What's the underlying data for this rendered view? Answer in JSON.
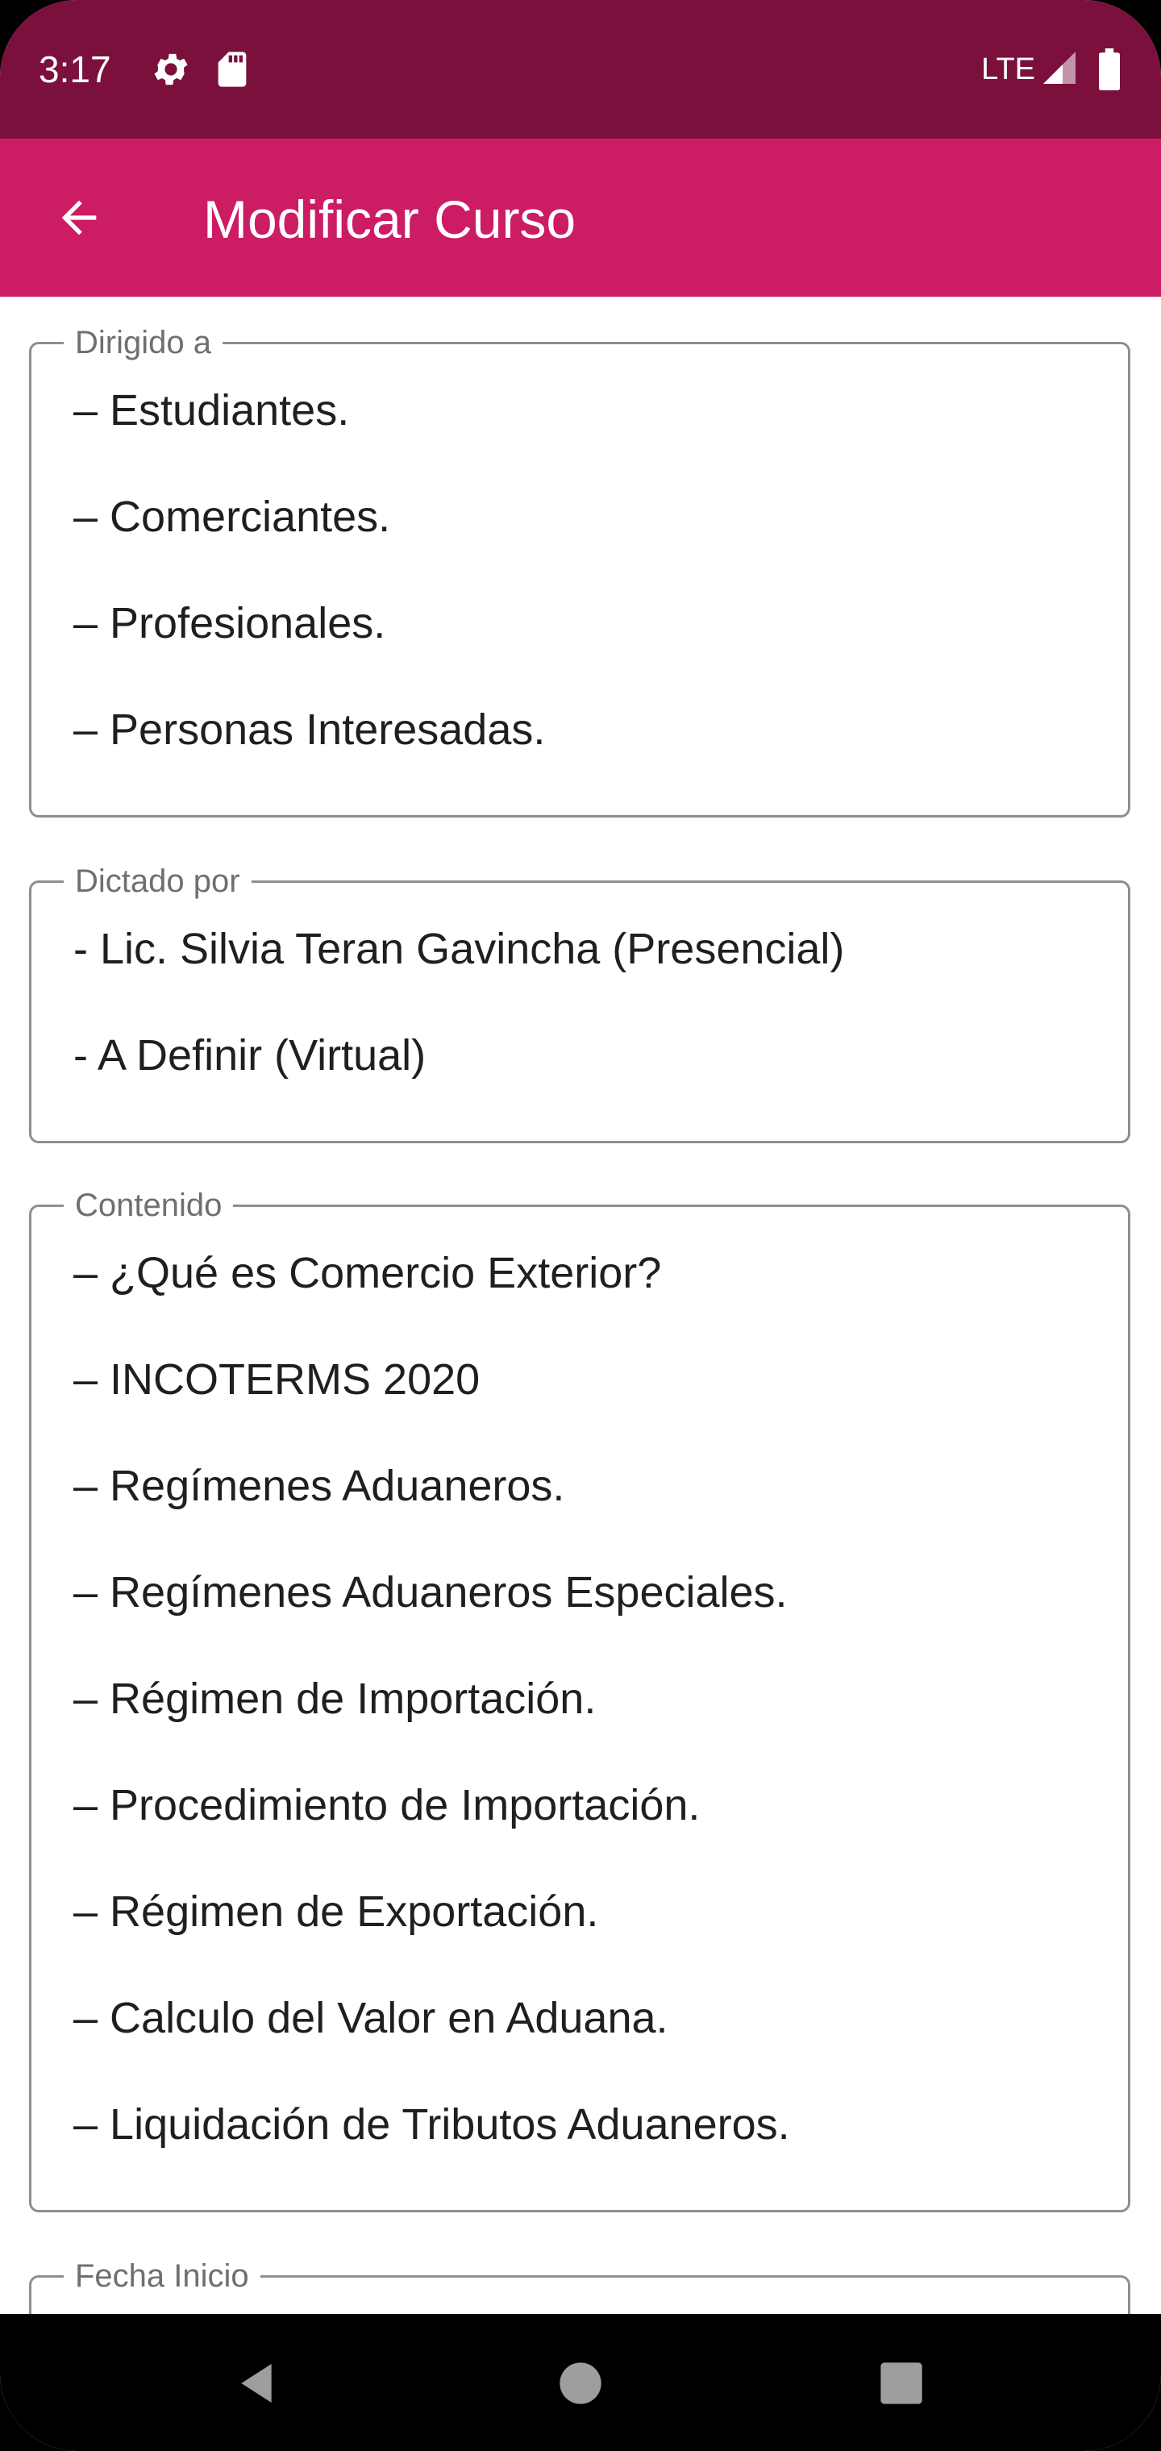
{
  "status_bar": {
    "time": "3:17",
    "network": "LTE",
    "icons": [
      "settings-icon",
      "sd-card-icon",
      "signal-icon",
      "battery-icon"
    ]
  },
  "app_bar": {
    "title": "Modificar Curso",
    "back_icon": "arrow-back-icon"
  },
  "fields": [
    {
      "label": "Dirigido a",
      "lines": [
        "– Estudiantes.",
        "– Comerciantes.",
        "– Profesionales.",
        "– Personas Interesadas."
      ]
    },
    {
      "label": "Dictado por",
      "lines": [
        "- Lic. Silvia Teran Gavincha (Presencial)",
        "- A Definir (Virtual)"
      ]
    },
    {
      "label": "Contenido",
      "lines": [
        "– ¿Qué es Comercio Exterior?",
        "– INCOTERMS 2020",
        "– Regímenes Aduaneros.",
        "– Regímenes Aduaneros Especiales.",
        "– Régimen de Importación.",
        "– Procedimiento de Importación.",
        "– Régimen de Exportación.",
        "– Calculo del Valor en Aduana.",
        "– Liquidación de Tributos Aduaneros."
      ]
    },
    {
      "label": "Fecha Inicio",
      "lines": []
    }
  ],
  "nav_bar": {
    "icons": [
      "back-triangle-icon",
      "home-circle-icon",
      "recents-square-icon"
    ]
  },
  "colors": {
    "status_bar": "#7c103c",
    "app_bar": "#cc1c63",
    "field_border": "#8f8f8f",
    "label_text": "#6f6f6f",
    "body_text": "#1f1f1f"
  }
}
